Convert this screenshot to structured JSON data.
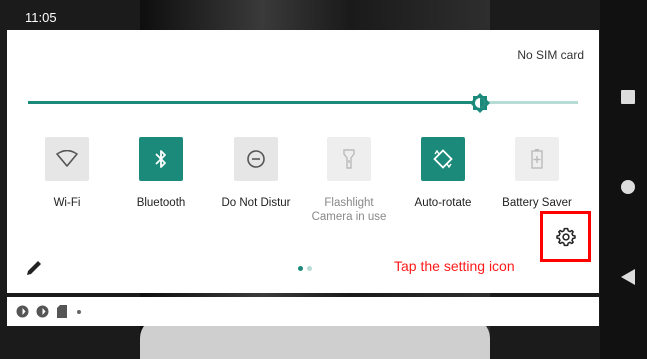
{
  "status_bar": {
    "time": "11:05"
  },
  "quick_settings": {
    "sim_status": "No SIM card",
    "brightness_level": 0.82,
    "tiles": [
      {
        "label": "Wi-Fi",
        "sub": "",
        "state": "off",
        "icon": "wifi-icon"
      },
      {
        "label": "Bluetooth",
        "sub": "",
        "state": "on",
        "icon": "bluetooth-icon"
      },
      {
        "label": "Do Not Distur",
        "sub": "",
        "state": "off",
        "icon": "do-not-disturb-icon"
      },
      {
        "label": "Flashlight",
        "sub": "Camera in use",
        "state": "disabled",
        "icon": "flashlight-icon"
      },
      {
        "label": "Auto-rotate",
        "sub": "",
        "state": "on",
        "icon": "auto-rotate-icon"
      },
      {
        "label": "Battery Saver",
        "sub": "",
        "state": "disabled",
        "icon": "battery-saver-icon"
      }
    ],
    "pages": {
      "count": 2,
      "current": 1
    },
    "annotation": "Tap the setting icon"
  },
  "notification_icons": [
    "status-icon",
    "status-icon",
    "sd-card-icon",
    "more-dot-icon"
  ],
  "nav_bar": {
    "buttons": [
      "recents-icon",
      "home-icon",
      "back-icon"
    ]
  },
  "colors": {
    "accent": "#1c8a7a",
    "accent_light": "#b7dcd6",
    "annotation": "#ff0000"
  }
}
